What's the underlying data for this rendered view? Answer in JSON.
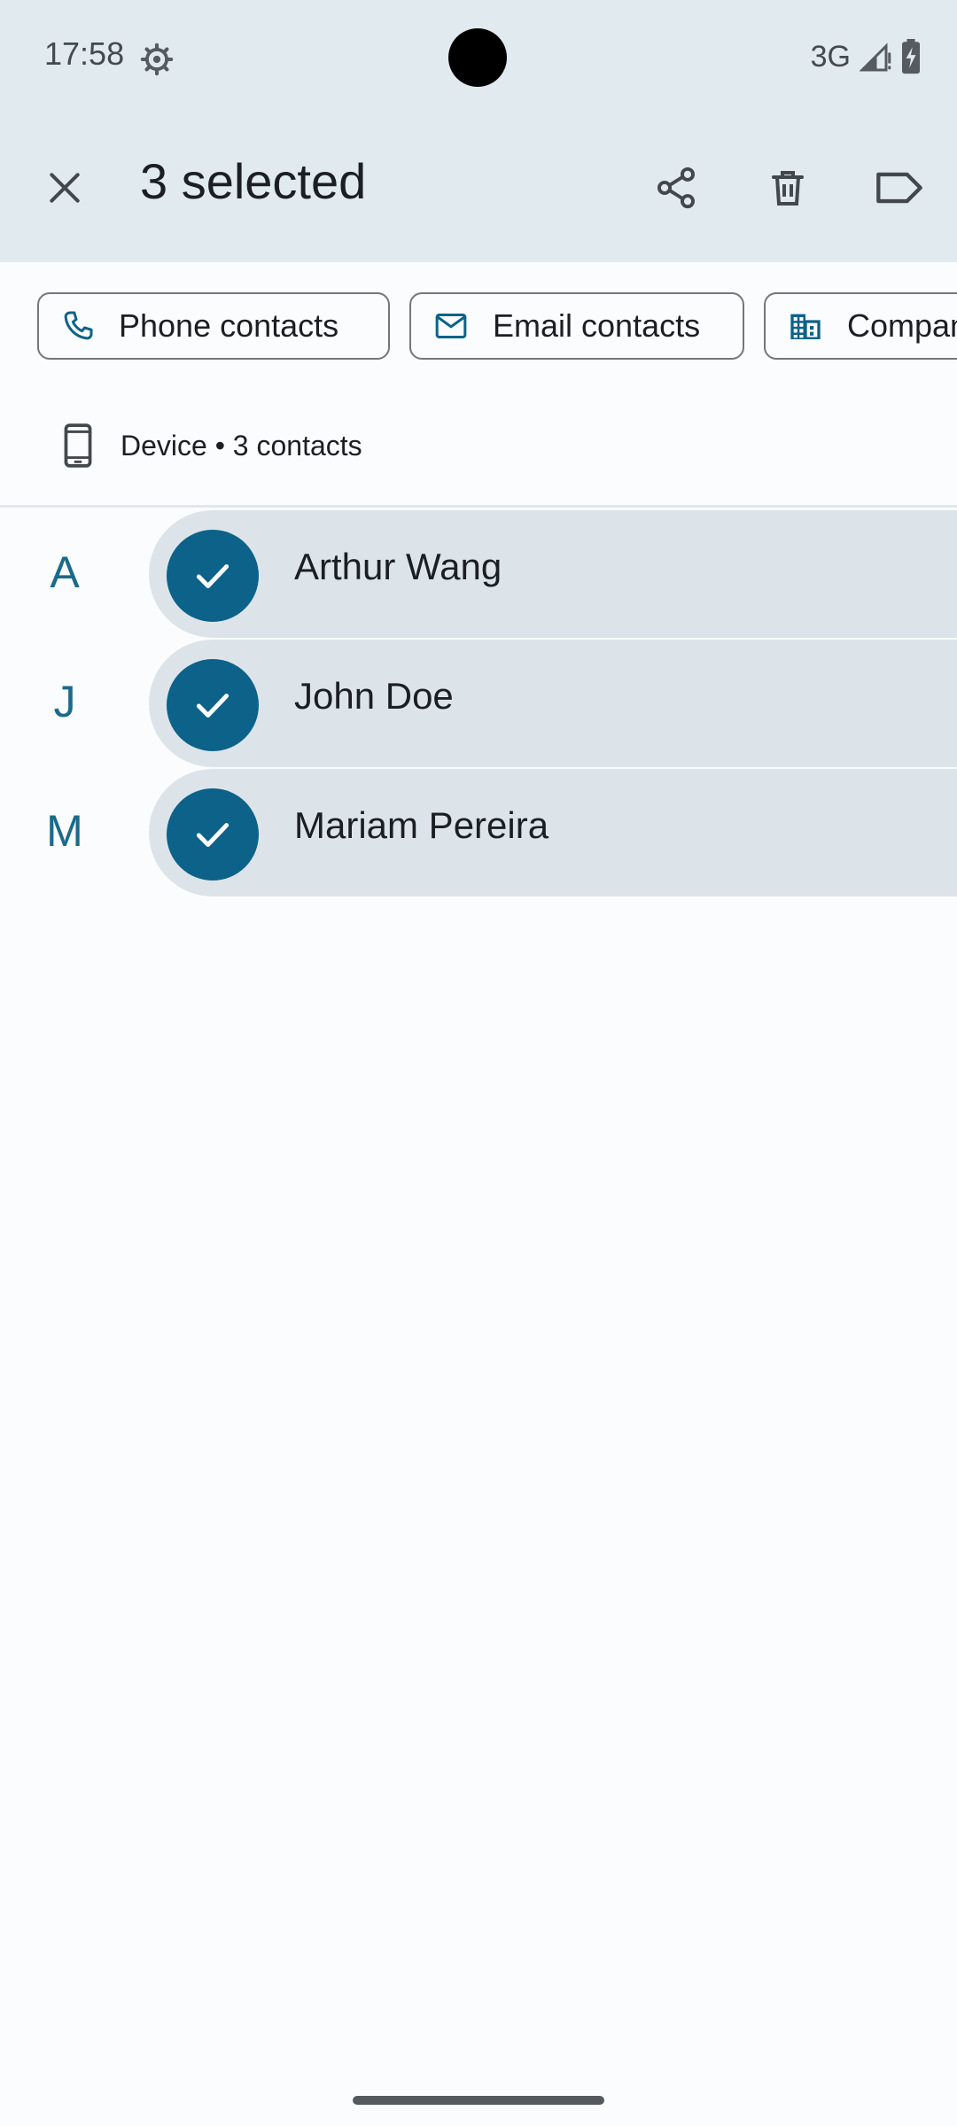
{
  "status_bar": {
    "time": "17:58",
    "network": "3G",
    "icons": [
      "settings-gear-icon",
      "signal-icon",
      "battery-charging-icon"
    ]
  },
  "action_bar": {
    "title": "3 selected",
    "close_icon": "close-icon",
    "actions": [
      {
        "name": "share",
        "icon": "share-icon"
      },
      {
        "name": "delete",
        "icon": "trash-icon"
      },
      {
        "name": "label",
        "icon": "label-icon"
      }
    ]
  },
  "filters": {
    "chips": [
      {
        "label": "Phone contacts",
        "icon": "phone-icon"
      },
      {
        "label": "Email contacts",
        "icon": "mail-icon"
      },
      {
        "label": "Company",
        "icon": "company-icon"
      }
    ]
  },
  "account": {
    "label": "Device • 3 contacts",
    "icon": "phone-device-icon"
  },
  "contacts": [
    {
      "letter": "A",
      "name": "Arthur Wang",
      "selected": true
    },
    {
      "letter": "J",
      "name": "John Doe",
      "selected": true
    },
    {
      "letter": "M",
      "name": "Mariam Pereira",
      "selected": true
    }
  ],
  "colors": {
    "header_bg": "#e0eaef",
    "accent": "#0c6289",
    "letter": "#1a6a8a",
    "selected_row": "#dde4e9",
    "background": "#fbfcfd"
  }
}
